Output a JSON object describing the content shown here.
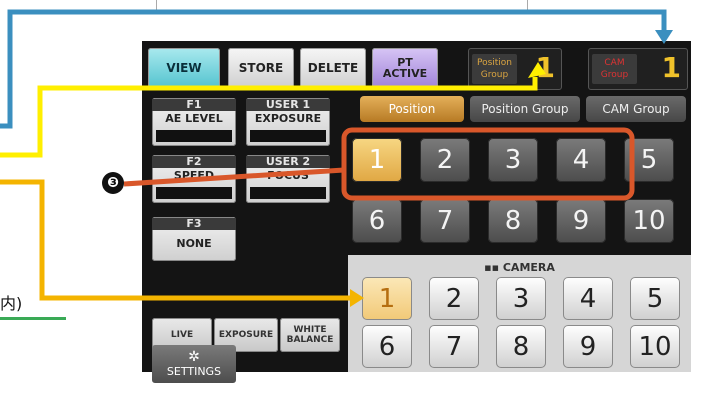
{
  "toolbar": {
    "view_label": "VIEW",
    "store_label": "STORE",
    "delete_label": "DELETE",
    "pt_active_label_line1": "PT",
    "pt_active_label_line2": "ACTIVE",
    "position_group_label_line1": "Position",
    "position_group_label_line2": "Group",
    "position_group_value": "1",
    "cam_group_label_line1": "CAM",
    "cam_group_label_line2": "Group",
    "cam_group_value": "1"
  },
  "fkeys": [
    {
      "title": "F1",
      "value": "AE LEVEL"
    },
    {
      "title": "USER 1",
      "value": "EXPOSURE"
    },
    {
      "title": "F2",
      "value": "SPEED"
    },
    {
      "title": "USER 2",
      "value": "FOCUS"
    },
    {
      "title": "F3",
      "value": "NONE"
    }
  ],
  "tabs": [
    "Position",
    "Position Group",
    "CAM Group"
  ],
  "position_keys": [
    "1",
    "2",
    "3",
    "4",
    "5",
    "6",
    "7",
    "8",
    "9",
    "10"
  ],
  "bottom_buttons": {
    "live": "LIVE",
    "exposure": "EXPOSURE",
    "white_balance_line1": "WHITE",
    "white_balance_line2": "BALANCE"
  },
  "camera_label": "CAMERA",
  "camera_keys": [
    "1",
    "2",
    "3",
    "4",
    "5",
    "6",
    "7",
    "8",
    "9",
    "10"
  ],
  "settings_label": "SETTINGS",
  "annotation_badge": "❸",
  "partial_text": "内)",
  "colors": {
    "highlight_orange": "#d9572a",
    "arrow_yellow": "#ffef00",
    "arrow_blue": "#3b8fbf",
    "arrow_gold": "#f4b400",
    "selected_key": "#f0c060",
    "view_button": "#53c3cf",
    "pt_active": "#9f82d8"
  }
}
